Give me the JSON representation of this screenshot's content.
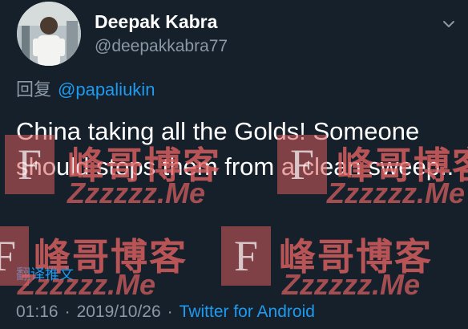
{
  "author": {
    "display_name": "Deepak Kabra",
    "handle": "@deepakkabra77"
  },
  "menu_icon": "chevron-down-icon",
  "reply": {
    "prefix": "回复",
    "mention": "@papaliukin"
  },
  "tweet": {
    "text": "China taking all the Golds! Someone should stops them from a clean sweep..",
    "translate_label": "翻译推文"
  },
  "meta": {
    "time": "01:16",
    "separator": "·",
    "date": "2019/10/26",
    "source": "Twitter for Android"
  },
  "watermark": {
    "letter": "F",
    "title": "峰哥博客",
    "domain": "Zzzzzz.Me"
  },
  "colors": {
    "background": "#15202b",
    "primary_text": "#ffffff",
    "secondary_text": "#8b98a5",
    "accent": "#1d9bf0",
    "watermark": "#de6060"
  }
}
